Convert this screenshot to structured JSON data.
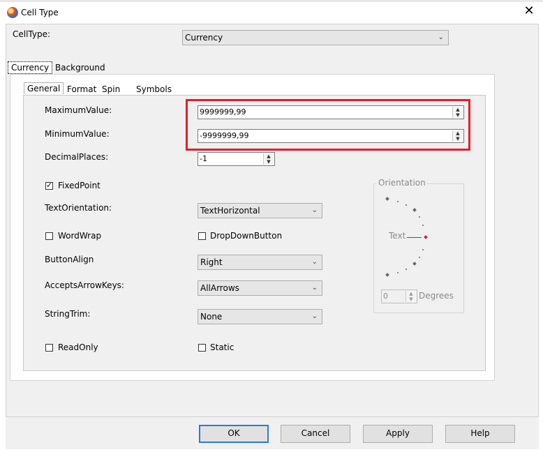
{
  "window": {
    "title": "Cell Type",
    "close_glyph": "✕"
  },
  "celltype": {
    "label": "CellType:",
    "value": "Currency"
  },
  "outer_tabs": [
    "Currency",
    "Background"
  ],
  "inner_tabs": [
    "General",
    "Format",
    "Spin",
    "Symbols"
  ],
  "fields": {
    "max_label": "MaximumValue:",
    "max_value": "9999999,99",
    "min_label": "MinimumValue:",
    "min_value": "-9999999,99",
    "decimal_label": "DecimalPlaces:",
    "decimal_value": "-1",
    "fixedpoint_label": "FixedPoint",
    "fixedpoint_checked": true,
    "textorient_label": "TextOrientation:",
    "textorient_value": "TextHorizontal",
    "wordwrap_label": "WordWrap",
    "dropdown_label": "DropDownButton",
    "buttonalign_label": "ButtonAlign",
    "buttonalign_value": "Right",
    "arrowkeys_label": "AcceptsArrowKeys:",
    "arrowkeys_value": "AllArrows",
    "stringtrim_label": "StringTrim:",
    "stringtrim_value": "None",
    "readonly_label": "ReadOnly",
    "static_label": "Static"
  },
  "orientation": {
    "group_label": "Orientation",
    "text_label": "Text",
    "degrees_value": "0",
    "degrees_label": "Degrees"
  },
  "buttons": {
    "ok": "OK",
    "cancel": "Cancel",
    "apply": "Apply",
    "help": "Help"
  },
  "colors": {
    "highlight": "#e0202a",
    "default_button": "#2a7bd4"
  }
}
